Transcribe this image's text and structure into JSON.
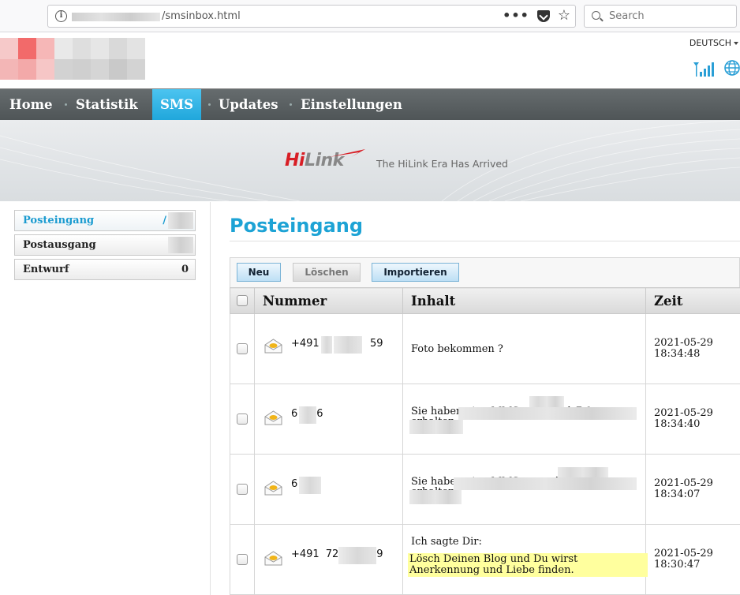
{
  "browser": {
    "url_path": "/smsinbox.html",
    "search_placeholder": "Search",
    "more_glyph": "•••",
    "star_glyph": "☆"
  },
  "header": {
    "language": "DEUTSCH"
  },
  "nav": {
    "items": [
      {
        "label": "Home",
        "active": false
      },
      {
        "label": "Statistik",
        "active": false
      },
      {
        "label": "SMS",
        "active": true
      },
      {
        "label": "Updates",
        "active": false
      },
      {
        "label": "Einstellungen",
        "active": false
      }
    ]
  },
  "banner": {
    "logo_hi": "Hi",
    "logo_link": "Link",
    "tagline": "The HiLink Era Has Arrived"
  },
  "sidebar": {
    "items": [
      {
        "label": "Posteingang",
        "count": "/",
        "active": true
      },
      {
        "label": "Postausgang",
        "count": "",
        "active": false
      },
      {
        "label": "Entwurf",
        "count": "0",
        "active": false
      }
    ]
  },
  "main": {
    "title": "Posteingang",
    "buttons": {
      "new": "Neu",
      "delete": "Löschen",
      "import": "Importieren"
    },
    "columns": {
      "number": "Nummer",
      "content": "Inhalt",
      "time": "Zeit"
    },
    "rows": [
      {
        "number_start": "+491",
        "number_mid": "7",
        "number_end": "59",
        "content_line1": "Foto bekommen ?",
        "content_line2": "",
        "date": "2021-05-29",
        "time": "18:34:48"
      },
      {
        "number_start": "6",
        "number_mid": "",
        "number_end": "6",
        "content_line1": "Sie haben eine MMS von +491  7            9",
        "content_line2": "erhalten.",
        "date": "2021-05-29",
        "time": "18:34:40"
      },
      {
        "number_start": "6",
        "number_mid": "",
        "number_end": "",
        "content_line1": "Sie haben eine MMS von +491  72          9",
        "content_line2": "erhalten.",
        "date": "2021-05-29",
        "time": "18:34:07"
      },
      {
        "number_start": "+491",
        "number_mid": "72",
        "number_end": "9",
        "content_line1": "Ich sagte Dir:",
        "content_highlight": "Lösch Deinen Blog und Du wirst Anerkennung und Liebe finden.",
        "date": "2021-05-29",
        "time": "18:30:47"
      }
    ]
  }
}
